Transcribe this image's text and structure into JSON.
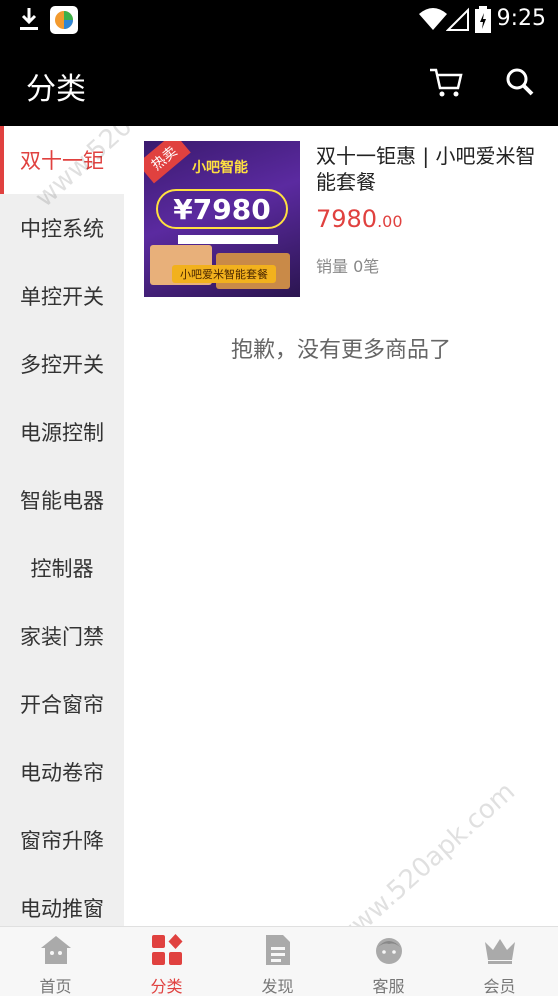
{
  "status_bar": {
    "time": "9:25"
  },
  "header": {
    "title": "分类",
    "cart_icon": "cart-icon",
    "search_icon": "search-icon"
  },
  "sidebar": {
    "items": [
      {
        "label": "双十一钜",
        "active": true
      },
      {
        "label": "中控系统"
      },
      {
        "label": "单控开关"
      },
      {
        "label": "多控开关"
      },
      {
        "label": "电源控制"
      },
      {
        "label": "智能电器"
      },
      {
        "label": "控制器"
      },
      {
        "label": "家装门禁"
      },
      {
        "label": "开合窗帘"
      },
      {
        "label": "电动卷帘"
      },
      {
        "label": "窗帘升降"
      },
      {
        "label": "电动推窗"
      }
    ]
  },
  "product": {
    "title": "双十一钜惠 | 小吧爱米智能套餐",
    "price_int": "7980",
    "price_dec": ".00",
    "sales_label": "销量",
    "sales_count": "0",
    "sales_unit": "笔",
    "image": {
      "hot_tag": "热卖",
      "brand": "小吧智能",
      "price": "¥7980",
      "caption": "小吧爱米智能套餐"
    }
  },
  "no_more_text": "抱歉，没有更多商品了",
  "tabbar": {
    "tabs": [
      {
        "label": "首页",
        "icon": "home-icon"
      },
      {
        "label": "分类",
        "icon": "category-icon",
        "active": true
      },
      {
        "label": "发现",
        "icon": "discover-icon"
      },
      {
        "label": "客服",
        "icon": "customer-service-icon"
      },
      {
        "label": "会员",
        "icon": "member-crown-icon"
      }
    ]
  },
  "watermark": "www.520apk.com",
  "colors": {
    "accent": "#e0413f",
    "header_bg": "#000000",
    "sidebar_bg": "#efefef"
  }
}
